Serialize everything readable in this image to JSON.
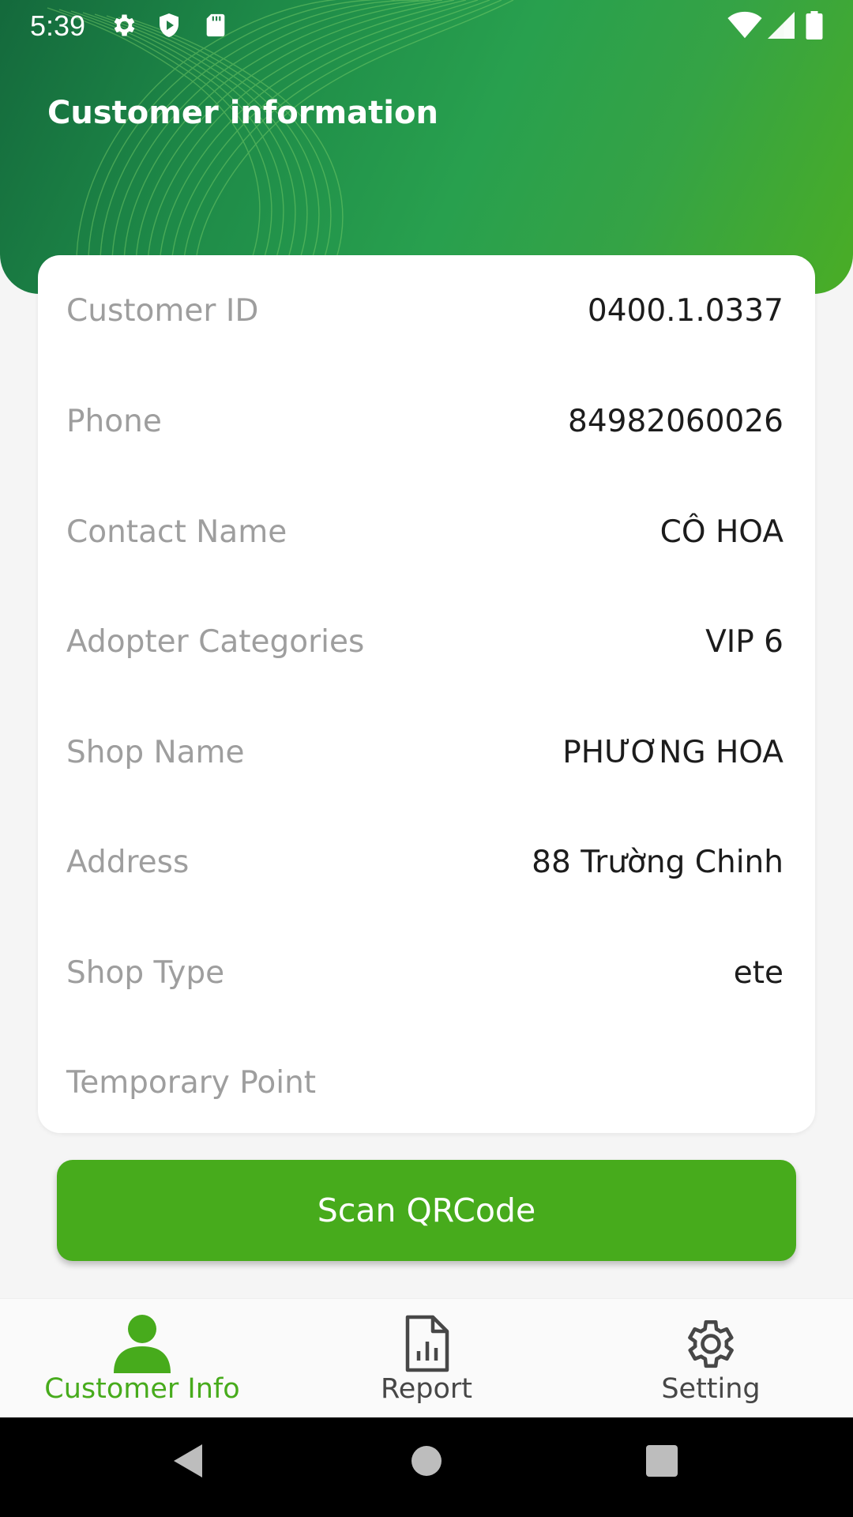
{
  "status_bar": {
    "time": "5:39",
    "left_icons": [
      "gear-icon",
      "shield-icon",
      "sd-card-icon"
    ],
    "right_icons": [
      "wifi-icon",
      "signal-icon",
      "battery-icon"
    ]
  },
  "header": {
    "title": "Customer information"
  },
  "customer": {
    "fields": [
      {
        "label": "Customer ID",
        "value": "0400.1.0337"
      },
      {
        "label": "Phone",
        "value": "84982060026"
      },
      {
        "label": "Contact Name",
        "value": "CÔ HOA"
      },
      {
        "label": "Adopter Categories",
        "value": "VIP 6"
      },
      {
        "label": "Shop Name",
        "value": "PHƯƠNG HOA"
      },
      {
        "label": "Address",
        "value": "88 Trường Chinh"
      },
      {
        "label": "Shop Type",
        "value": "ete"
      },
      {
        "label": "Temporary Point",
        "value": ""
      }
    ]
  },
  "actions": {
    "scan_label": "Scan QRCode"
  },
  "bottom_nav": {
    "items": [
      {
        "label": "Customer Info",
        "icon": "person-icon",
        "active": true
      },
      {
        "label": "Report",
        "icon": "report-icon",
        "active": false
      },
      {
        "label": "Setting",
        "icon": "gear-icon",
        "active": false
      }
    ]
  },
  "system_nav": {
    "icons": [
      "back-icon",
      "home-icon",
      "recents-icon"
    ]
  },
  "colors": {
    "accent": "#47ab1c",
    "header_dark": "#14693c",
    "header_light": "#4aad25",
    "label_gray": "#9e9e9e",
    "value_dark": "#1c1c1c"
  }
}
